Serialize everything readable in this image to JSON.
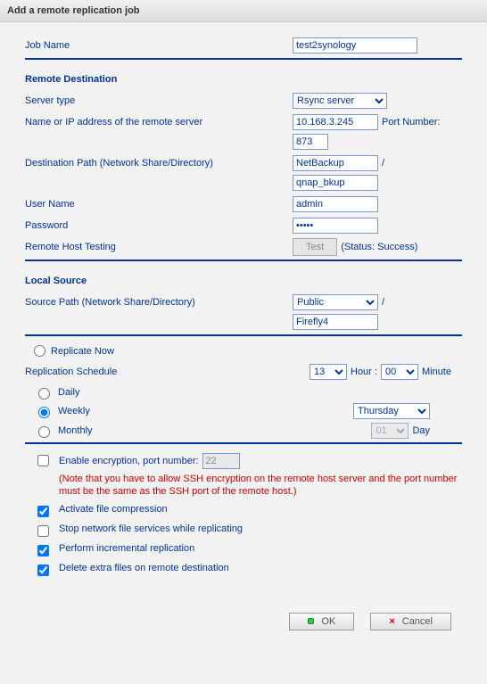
{
  "window_title": "Add a remote replication job",
  "job_name_label": "Job Name",
  "job_name_value": "test2synology",
  "remote_dest": {
    "title": "Remote Destination",
    "server_type_label": "Server type",
    "server_type_value": "Rsync server",
    "name_ip_label": "Name or IP address of the remote server",
    "name_ip_value": "10.168.3.245",
    "port_label": "Port Number:",
    "port_value": "873",
    "dest_path_label": "Destination Path (Network Share/Directory)",
    "dest_path_share": "NetBackup",
    "dest_path_dir": "qnap_bkup",
    "user_label": "User Name",
    "user_value": "admin",
    "pass_label": "Password",
    "pass_value": "•••••",
    "test_label": "Remote Host Testing",
    "test_button": "Test",
    "test_status": "(Status: Success)"
  },
  "local_source": {
    "title": "Local Source",
    "path_label": "Source Path (Network Share/Directory)",
    "share_value": "Public",
    "dir_value": "Firefly4"
  },
  "schedule": {
    "replicate_now": "Replicate Now",
    "title": "Replication Schedule",
    "hour": "13",
    "hour_label": "Hour :",
    "minute": "00",
    "minute_label": "Minute",
    "daily": "Daily",
    "weekly": "Weekly",
    "weekday": "Thursday",
    "monthly": "Monthly",
    "day": "01",
    "day_label": "Day",
    "selected": "weekly"
  },
  "options": {
    "encrypt_label": "Enable encryption, port number:",
    "encrypt_port": "22",
    "encrypt_note": "(Note that you have to allow SSH encryption on the remote host server and the port number must be the same as the SSH port of the remote host.)",
    "compress": "Activate file compression",
    "stop_services": "Stop network file services while replicating",
    "incremental": "Perform incremental replication",
    "delete_extra": "Delete extra files on remote destination",
    "encrypt_checked": false,
    "compress_checked": true,
    "stop_services_checked": false,
    "incremental_checked": true,
    "delete_extra_checked": true
  },
  "buttons": {
    "ok": "OK",
    "cancel": "Cancel"
  }
}
